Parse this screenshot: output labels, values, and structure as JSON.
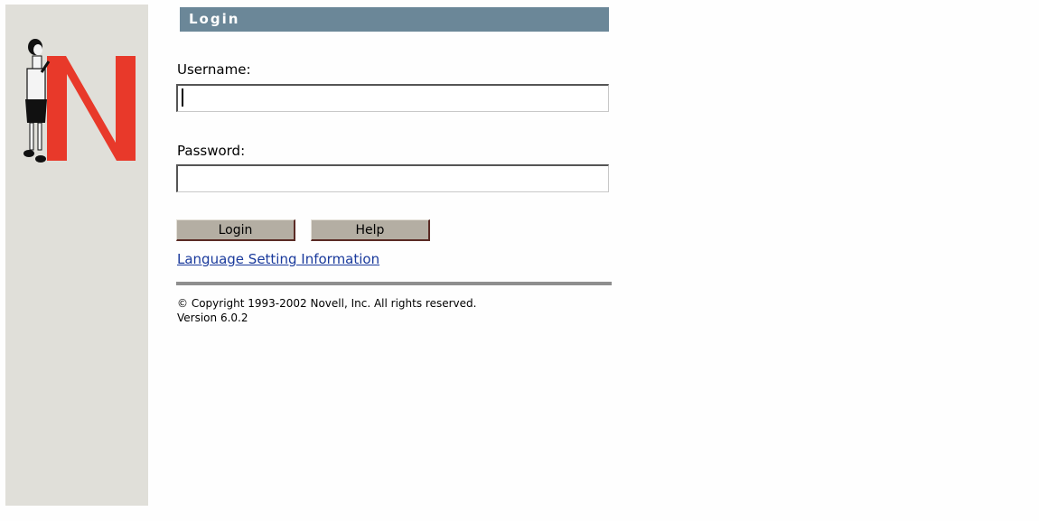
{
  "header": {
    "title": "Login"
  },
  "form": {
    "username_label": "Username:",
    "username_value": "",
    "password_label": "Password:",
    "password_value": ""
  },
  "buttons": {
    "login_label": "Login",
    "help_label": "Help"
  },
  "links": {
    "language": "Language Setting Information"
  },
  "footer": {
    "copyright": "© Copyright 1993-2002 Novell, Inc. All rights reserved.",
    "version": "Version 6.0.2"
  },
  "colors": {
    "header_bar": "#6b8798",
    "sidebar": "#e0dfd9",
    "logo_red": "#e8392a",
    "button": "#b4aea3",
    "link": "#1a3a9c"
  },
  "icons": {
    "logo": "novell-n-figure-logo"
  }
}
